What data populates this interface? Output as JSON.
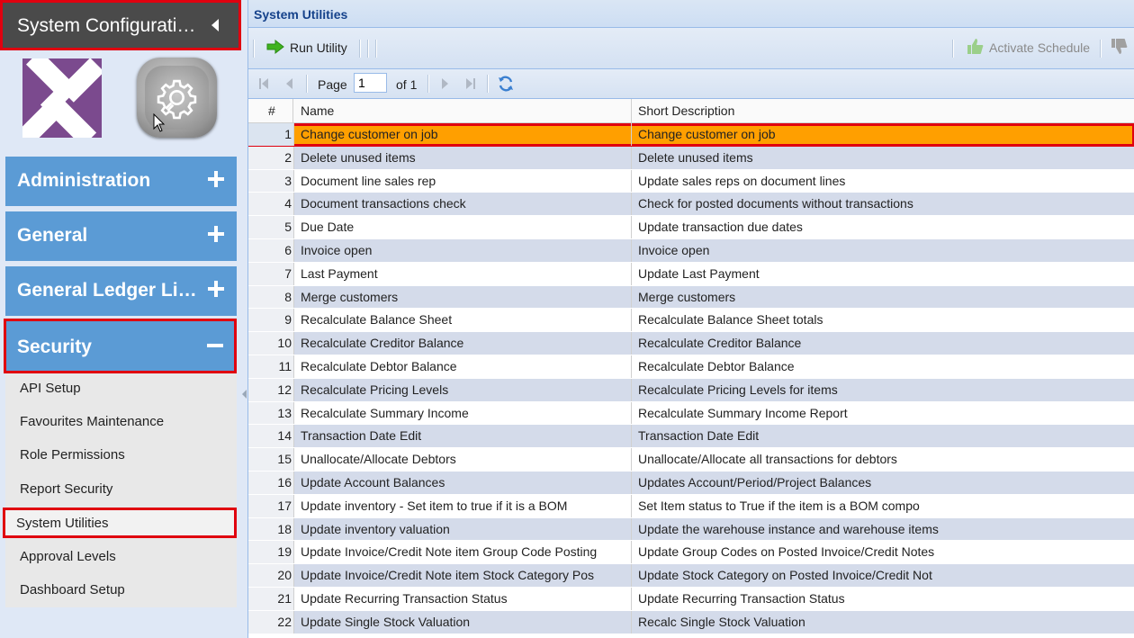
{
  "sidebar": {
    "title": "System Configuration",
    "sections": [
      {
        "label": "Administration",
        "expanded": false
      },
      {
        "label": "General",
        "expanded": false
      },
      {
        "label": "General Ledger Lines",
        "expanded": false
      },
      {
        "label": "Security",
        "expanded": true
      }
    ],
    "security_items": [
      "API Setup",
      "Favourites Maintenance",
      "Role Permissions",
      "Report Security",
      "System Utilities",
      "Approval Levels",
      "Dashboard Setup"
    ],
    "selected_item": "System Utilities"
  },
  "panel": {
    "title": "System Utilities"
  },
  "toolbar": {
    "run_label": "Run Utility",
    "activate_label": "Activate Schedule"
  },
  "pager": {
    "page_label": "Page",
    "page_value": "1",
    "of_label": "of 1"
  },
  "grid": {
    "columns": [
      "#",
      "Name",
      "Short Description"
    ],
    "rows": [
      {
        "n": "1",
        "name": "Change customer on job",
        "desc": "Change customer on job"
      },
      {
        "n": "2",
        "name": "Delete unused items",
        "desc": "Delete unused items"
      },
      {
        "n": "3",
        "name": "Document line sales rep",
        "desc": "Update sales reps on document lines"
      },
      {
        "n": "4",
        "name": "Document transactions check",
        "desc": "Check for posted documents without transactions"
      },
      {
        "n": "5",
        "name": "Due Date",
        "desc": "Update transaction due dates"
      },
      {
        "n": "6",
        "name": "Invoice open",
        "desc": "Invoice open"
      },
      {
        "n": "7",
        "name": "Last Payment",
        "desc": "Update Last Payment"
      },
      {
        "n": "8",
        "name": "Merge customers",
        "desc": "Merge customers"
      },
      {
        "n": "9",
        "name": "Recalculate Balance Sheet",
        "desc": "Recalculate Balance Sheet totals"
      },
      {
        "n": "10",
        "name": "Recalculate Creditor Balance",
        "desc": "Recalculate Creditor Balance"
      },
      {
        "n": "11",
        "name": "Recalculate Debtor Balance",
        "desc": "Recalculate Debtor Balance"
      },
      {
        "n": "12",
        "name": "Recalculate Pricing Levels",
        "desc": "Recalculate Pricing Levels for items"
      },
      {
        "n": "13",
        "name": "Recalculate Summary Income",
        "desc": "Recalculate Summary Income Report"
      },
      {
        "n": "14",
        "name": "Transaction Date Edit",
        "desc": "Transaction Date Edit"
      },
      {
        "n": "15",
        "name": "Unallocate/Allocate Debtors",
        "desc": "Unallocate/Allocate all transactions for debtors"
      },
      {
        "n": "16",
        "name": "Update Account Balances",
        "desc": "Updates Account/Period/Project Balances"
      },
      {
        "n": "17",
        "name": "Update inventory - Set item to true if it is a BOM",
        "desc": "Set Item status to True if the item is a BOM compo"
      },
      {
        "n": "18",
        "name": "Update inventory valuation",
        "desc": "Update the warehouse instance and warehouse items"
      },
      {
        "n": "19",
        "name": "Update Invoice/Credit Note item Group Code Posting",
        "desc": "Update Group Codes on Posted Invoice/Credit Notes"
      },
      {
        "n": "20",
        "name": "Update Invoice/Credit Note item Stock Category Pos",
        "desc": "Update Stock Category on Posted Invoice/Credit Not"
      },
      {
        "n": "21",
        "name": "Update Recurring Transaction Status",
        "desc": "Update Recurring Transaction Status"
      },
      {
        "n": "22",
        "name": "Update Single Stock Valuation",
        "desc": "Recalc Single Stock Valuation"
      }
    ],
    "selected_row": 0
  },
  "colors": {
    "accent": "#5b9bd5",
    "highlight": "#e0000f",
    "selected_row": "#ff9f00",
    "header_dark": "#4a4a4a"
  }
}
